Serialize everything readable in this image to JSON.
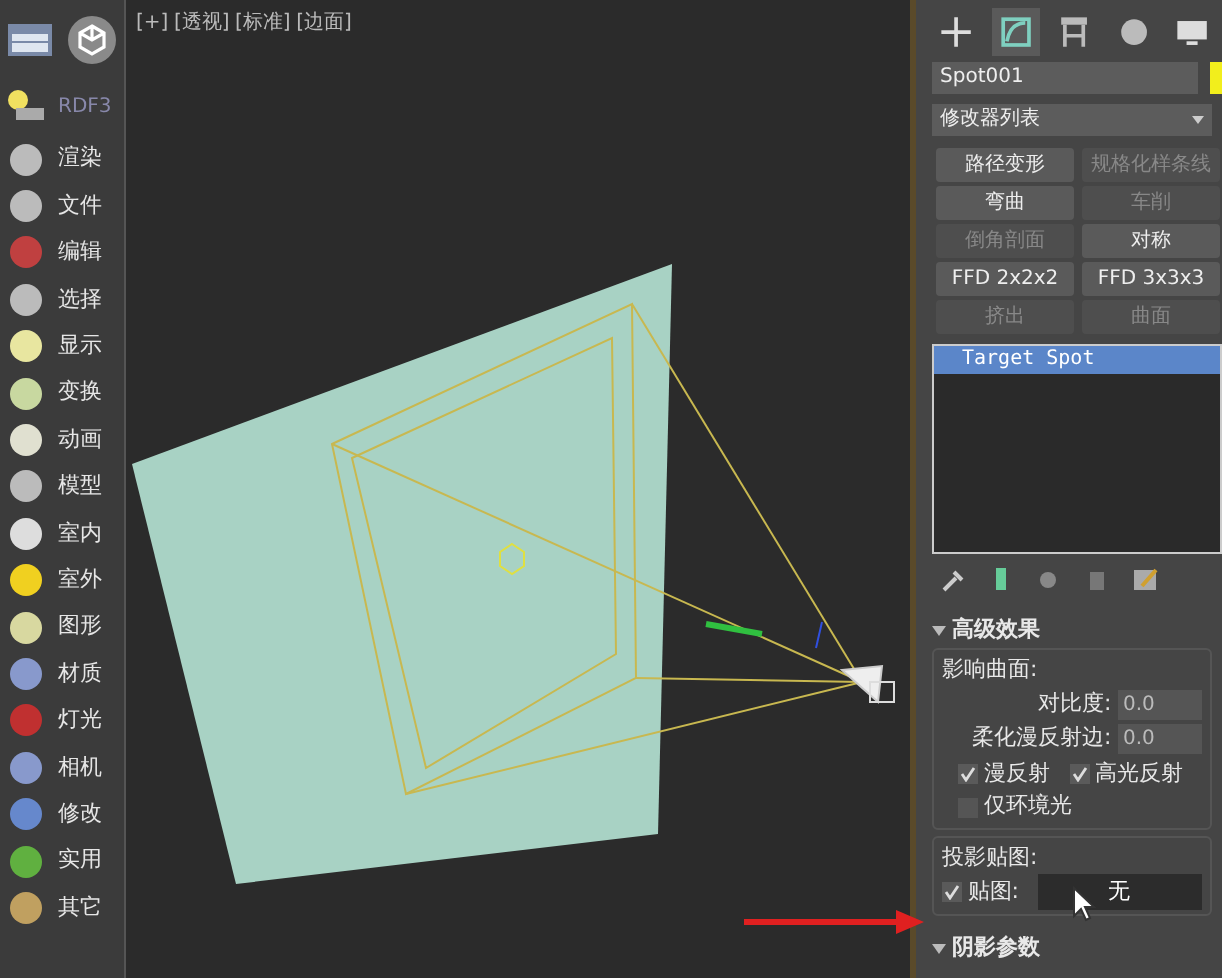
{
  "sidebar": {
    "header_label": "RDF3",
    "items": [
      {
        "label": "渲染"
      },
      {
        "label": "文件"
      },
      {
        "label": "编辑"
      },
      {
        "label": "选择"
      },
      {
        "label": "显示"
      },
      {
        "label": "变换"
      },
      {
        "label": "动画"
      },
      {
        "label": "模型"
      },
      {
        "label": "室内"
      },
      {
        "label": "室外"
      },
      {
        "label": "图形"
      },
      {
        "label": "材质"
      },
      {
        "label": "灯光"
      },
      {
        "label": "相机"
      },
      {
        "label": "修改"
      },
      {
        "label": "实用"
      },
      {
        "label": "其它"
      }
    ]
  },
  "viewport": {
    "labels": [
      "[+]",
      "[透视]",
      "[标准]",
      "[边面]"
    ]
  },
  "command_tabs": [
    {
      "kind": "create",
      "selected": false
    },
    {
      "kind": "modify",
      "selected": true
    },
    {
      "kind": "hierarchy",
      "selected": false
    },
    {
      "kind": "motion",
      "selected": false
    },
    {
      "kind": "display",
      "selected": false
    }
  ],
  "object": {
    "name": "Spot001",
    "color": "#f2ee1c"
  },
  "modifier_list": "修改器列表",
  "modifier_buttons": [
    {
      "label": "路径变形",
      "disabled": false
    },
    {
      "label": "规格化样条线",
      "disabled": true
    },
    {
      "label": "弯曲",
      "disabled": false
    },
    {
      "label": "车削",
      "disabled": true
    },
    {
      "label": "倒角剖面",
      "disabled": true
    },
    {
      "label": "对称",
      "disabled": false
    },
    {
      "label": "FFD 2x2x2",
      "disabled": false
    },
    {
      "label": "FFD 3x3x3",
      "disabled": false
    },
    {
      "label": "挤出",
      "disabled": true
    },
    {
      "label": "曲面",
      "disabled": true
    }
  ],
  "stack": [
    {
      "label": "Target Spot",
      "selected": true
    }
  ],
  "advanced_effects": {
    "title": "高级效果",
    "affect_surfaces_label": "影响曲面:",
    "spinners": [
      {
        "label": "对比度:",
        "value": "0.0"
      },
      {
        "label": "柔化漫反射边:",
        "value": "0.0"
      }
    ],
    "checks": [
      {
        "label": "漫反射",
        "checked": true
      },
      {
        "label": "高光反射",
        "checked": true
      },
      {
        "label": "仅环境光",
        "checked": false
      }
    ],
    "projector_label": "投影贴图:",
    "map": {
      "label": "贴图:",
      "checked": true,
      "button": "无"
    }
  },
  "shadow_params": {
    "title": "阴影参数"
  }
}
